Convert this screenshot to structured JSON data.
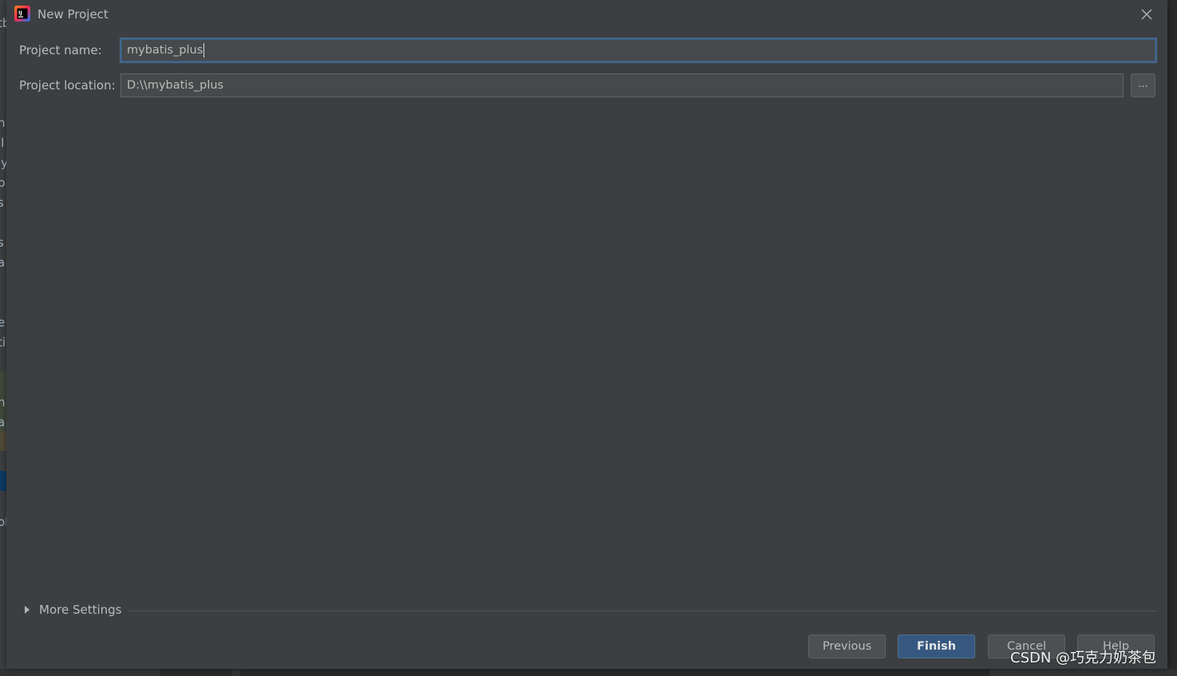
{
  "dialog": {
    "title": "New Project",
    "close_glyph": "✕"
  },
  "form": {
    "project_name_label": "Project name:",
    "project_name_value": "mybatis_plus",
    "project_location_label": "Project location:",
    "project_location_value": "D:\\\\mybatis_plus",
    "browse_label": "..."
  },
  "more_settings": {
    "label": "More Settings",
    "expanded": false
  },
  "buttons": {
    "previous": "Previous",
    "finish": "Finish",
    "cancel": "Cancel",
    "help": "Help"
  },
  "background_fragments": [
    "tb",
    "n",
    "ll",
    "ly",
    "p",
    "s",
    "s",
    "a",
    "e",
    "ti",
    "n",
    "a",
    "ol"
  ],
  "watermark": "CSDN @巧克力奶茶包",
  "colors": {
    "dialog_bg": "#3c3f41",
    "input_bg": "#45494a",
    "focus_border": "#3d6185",
    "primary_button": "#365880",
    "text": "#bbbbbb"
  },
  "icons": {
    "app": "intellij-idea-icon",
    "close": "close-icon",
    "expand": "triangle-right-icon"
  }
}
